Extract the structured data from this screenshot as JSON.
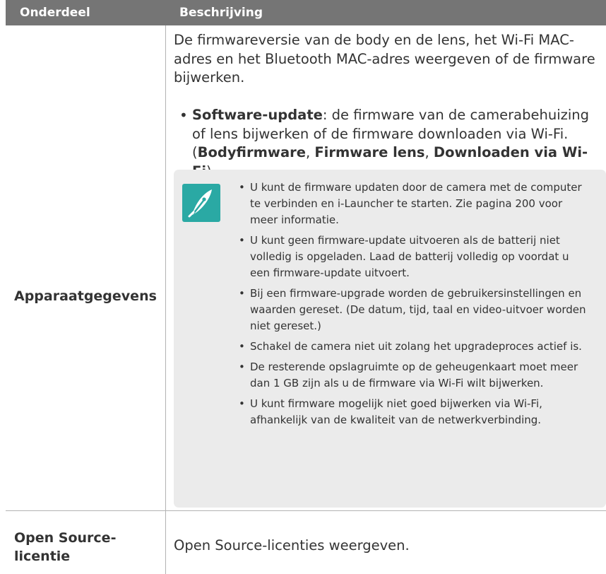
{
  "header": {
    "col1": "Onderdeel",
    "col2": "Beschrijving"
  },
  "rows": [
    {
      "label": "Apparaatgegevens",
      "description": "De firmwareversie van de body en de lens, het Wi-Fi MAC-adres en het Bluetooth MAC-adres weergeven of de firmware bijwerken.",
      "bullet": {
        "title": "Software-update",
        "text": ": de firmware van de camerabehuizing of lens bijwerken of de firmware downloaden via Wi-Fi.",
        "open_paren": "(",
        "option1": "Bodyfirmware",
        "sep1": ", ",
        "option2": "Firmware lens",
        "sep2": ", ",
        "option3": "Downloaden via Wi-Fi",
        "close_paren": ")"
      },
      "notes": [
        "U kunt de firmware updaten door de camera met de computer te verbinden en i-Launcher te starten. Zie pagina 200 voor meer informatie.",
        "U kunt geen firmware-update uitvoeren als de batterij niet volledig is opgeladen. Laad de batterij volledig op voordat u een firmware-update uitvoert.",
        "Bij een firmware-upgrade worden de gebruikersinstellingen en waarden gereset. (De datum, tijd, taal en video-uitvoer worden niet gereset.)",
        "Schakel de camera niet uit zolang het upgradeproces actief is.",
        "De resterende opslagruimte op de geheugenkaart moet meer dan 1 GB zijn als u de firmware via Wi-Fi wilt bijwerken.",
        "U kunt firmware mogelijk niet goed bijwerken via Wi-Fi, afhankelijk van de kwaliteit van de netwerkverbinding."
      ]
    },
    {
      "label": "Open Source-licentie",
      "description": "Open Source-licenties weergeven."
    }
  ],
  "bullet_char": "•",
  "note_icon": "pen-nib-note-icon",
  "colors": {
    "header_bg": "#757575",
    "note_bg": "#ebebeb",
    "icon_teal": "#2aa9a4"
  }
}
